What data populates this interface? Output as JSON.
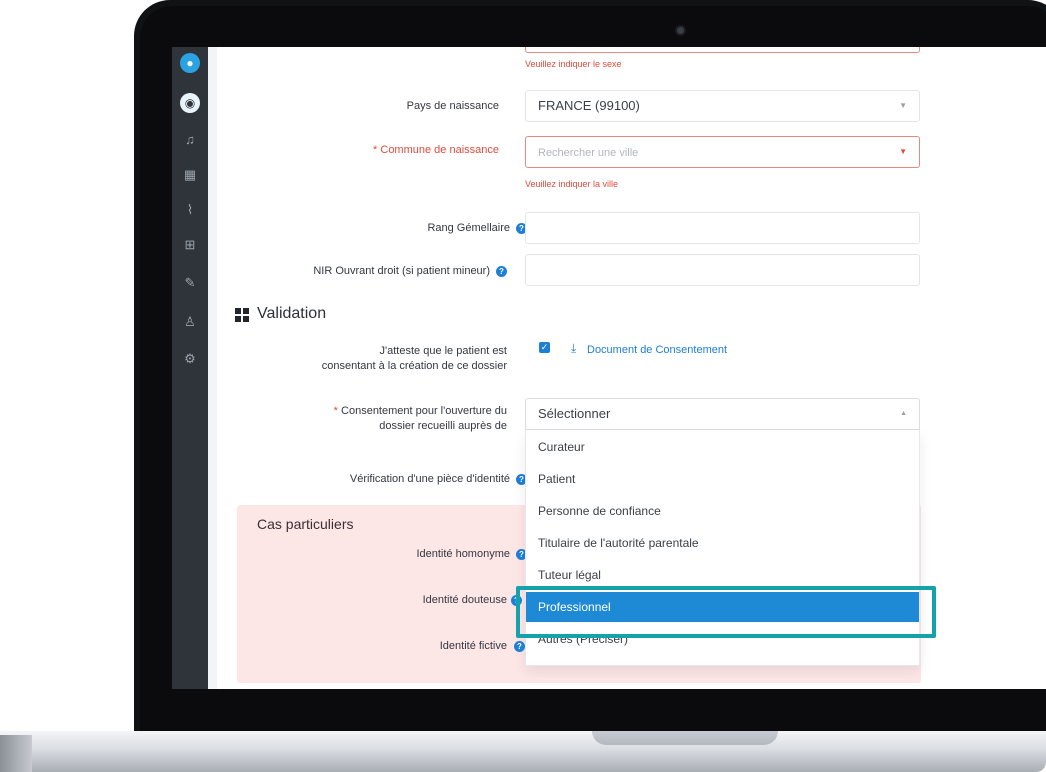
{
  "form": {
    "sexe_error": "Veuillez indiquer le sexe",
    "pays_label": "Pays de naissance",
    "pays_value": "FRANCE (99100)",
    "commune_label": "Commune de naissance",
    "commune_placeholder": "Rechercher une ville",
    "commune_error": "Veuillez indiquer la ville",
    "rang_label": "Rang Gémellaire",
    "nir_label": "NIR Ouvrant droit (si patient mineur)",
    "required_mark": "*"
  },
  "validation": {
    "title": "Validation",
    "attest_label_1": "J'atteste que le patient est",
    "attest_label_2": "consentant à la création de ce dossier",
    "doc_link": "Document de Consentement",
    "consent_label_1": "Consentement pour l'ouverture du",
    "consent_label_2": "dossier recueilli auprès de",
    "consent_value": "Sélectionner",
    "verif_label": "Vérification d'une pièce d'identité",
    "options": [
      "Curateur",
      "Patient",
      "Personne de confiance",
      "Titulaire de l'autorité parentale",
      "Tuteur légal",
      "Professionnel",
      "Autres (Préciser)"
    ],
    "selected_option": "Professionnel"
  },
  "cas": {
    "title": "Cas particuliers",
    "homonyme": "Identité homonyme",
    "douteuse": "Identité douteuse",
    "fictive": "Identité fictive"
  },
  "icons": {
    "help": "?",
    "check": "✓",
    "download": "⤓",
    "caret_down": "▼",
    "caret_up": "▲"
  },
  "colors": {
    "accent": "#1e8ad6",
    "error": "#e04b3c",
    "highlight": "#14a3ad"
  }
}
